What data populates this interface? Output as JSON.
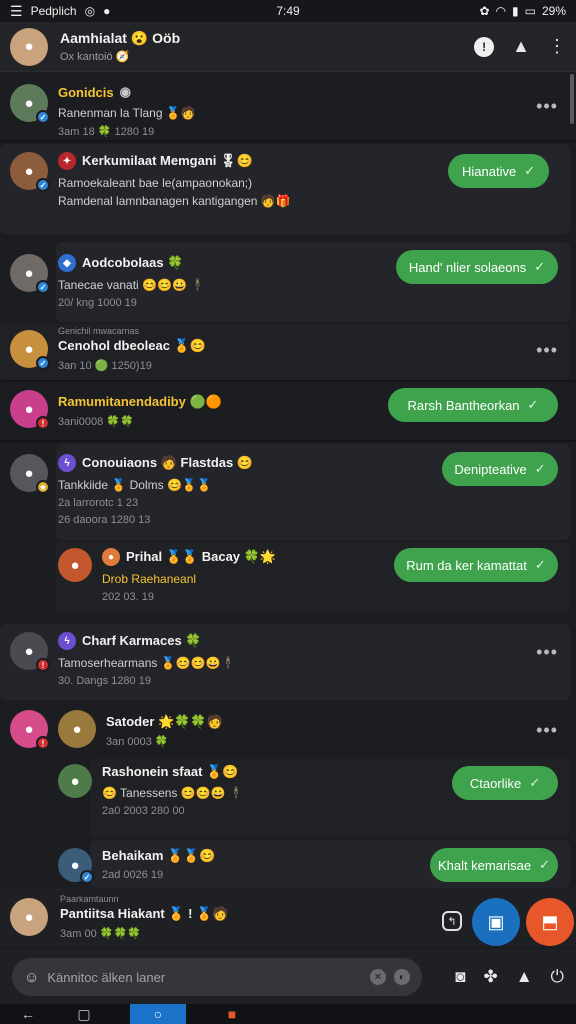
{
  "status": {
    "app": "Pedplich",
    "time": "7:49",
    "battery": "29%"
  },
  "header": {
    "title": "Aamhialat 😮 Oöb",
    "subtitle": "Ox kantoiö 🧭"
  },
  "feed": [
    {
      "name": "Gonidcis",
      "gold": true,
      "line2": "Ranenman la Tlang 🏅🧑",
      "line3": "3am 18 🍀 1280 19",
      "pill": "",
      "more": true
    },
    {
      "name": "Kerkumilaat Memgani 🎖😊",
      "line2": "Ramoekaleant bae le(ampaonokan;)",
      "line2b": "Ramdenal lamnbanagen kantigangen 🧑🎁",
      "line3": "",
      "pill": "Hianative"
    },
    {
      "name": "Aodcobolaas 🍀",
      "line2": "Tanecae vanati 😊😊😀 🕴",
      "line3": "20/ kng 1000 19",
      "pill": "Hand' nlier solaeons"
    },
    {
      "pre": "Genichil mwacarnas",
      "name": "Cenohol dbeoleac 🏅😊",
      "line2": "",
      "line3": "3an 10 🟢 1250)19",
      "pill": "",
      "more": true
    },
    {
      "name": "Ramumitanendadiby 🟢🟠",
      "gold": true,
      "line2": "",
      "line3": "3ani0008 🍀🍀",
      "pill": "Rarsh Bantheorkan"
    },
    {
      "name": "Conouiaons 🧑 Flastdas 😊",
      "line2": "Tankkiide 🏅 Dolms 😊🏅🏅",
      "line3": "2a larrorotc 1 23",
      "line4": "26 daoora 1280 13",
      "pill": "Denipteative"
    },
    {
      "name": "Prihal 🏅🏅 Bacay 🍀🌟",
      "sub_gold": "Drob Raehaneanl",
      "line3": "202 03. 19",
      "pill": "Rum da ker kamattat"
    },
    {
      "name": "Charf Karmaces 🍀",
      "line2": "Tamoserhearmans 🏅😊😊😀🕴",
      "line3": "30. Dangs 1280 19",
      "pill": "",
      "more": true
    },
    {
      "name": "Satoder 🌟🍀🍀🧑",
      "line2": "",
      "line3": "3an 0003 🍀",
      "pill": "",
      "more": true
    },
    {
      "name": "Rashonein sfaat 🏅😊",
      "line2": "😊 Tanessens 😊😊😀 🕴",
      "line3": "2a0 2003 280 00",
      "pill": "Ctaorlike"
    },
    {
      "name": "Behaikam 🏅🏅😊",
      "line2": "",
      "line3": "2ad 0026 19",
      "pill": "Khalt kemarisae"
    }
  ],
  "bottom": {
    "pre": "Paarkamtaunn",
    "name": "Pantiitsa Hiakant 🏅 ! 🏅🧑",
    "line3": "3am 00 🍀🍀🍀"
  },
  "composer": {
    "placeholder": "Kännitoc älken laner"
  },
  "colors": {
    "accent_green": "#3fa34d",
    "fab_blue": "#1a6fbf",
    "fab_orange": "#e8572a",
    "gold_name": "#f4c431"
  }
}
